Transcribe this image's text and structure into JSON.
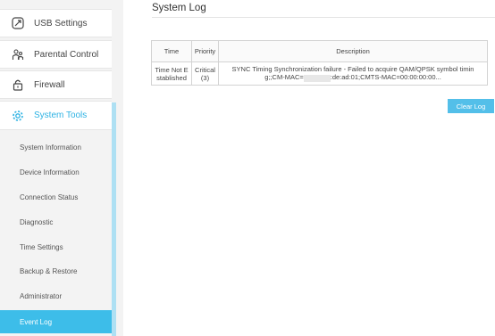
{
  "sidebar": {
    "main_items": [
      {
        "label": "USB Settings",
        "icon": "usb-settings-icon"
      },
      {
        "label": "Parental Control",
        "icon": "parental-control-icon"
      },
      {
        "label": "Firewall",
        "icon": "lock-icon"
      },
      {
        "label": "System Tools",
        "icon": "gear-icon",
        "active": true
      }
    ],
    "sub_items": [
      {
        "label": "System Information"
      },
      {
        "label": "Device Information"
      },
      {
        "label": "Connection Status"
      },
      {
        "label": "Diagnostic"
      },
      {
        "label": "Time Settings"
      },
      {
        "label": "Backup & Restore"
      },
      {
        "label": "Administrator"
      },
      {
        "label": "Event Log",
        "active": true
      }
    ]
  },
  "main": {
    "title": "System Log",
    "table": {
      "headers": [
        "Time",
        "Priority",
        "Description"
      ],
      "rows": [
        {
          "time": "Time Not Established",
          "priority_label": "Critical",
          "priority_level": "(3)",
          "description_line1": "SYNC Timing Synchronization failure - Failed to acquire QAM/QPSK symbol timin",
          "description_line2_prefix": "g;;CM-MAC=",
          "description_line2_suffix": ":de:ad:01;CMTS-MAC=00:00:00:00..."
        }
      ]
    },
    "clear_button": "Clear Log"
  },
  "colors": {
    "accent": "#2db2e3",
    "active_bg": "#3dbde9",
    "button_bg": "#53bfe9",
    "sidebar_bg": "#f3f3f3"
  }
}
